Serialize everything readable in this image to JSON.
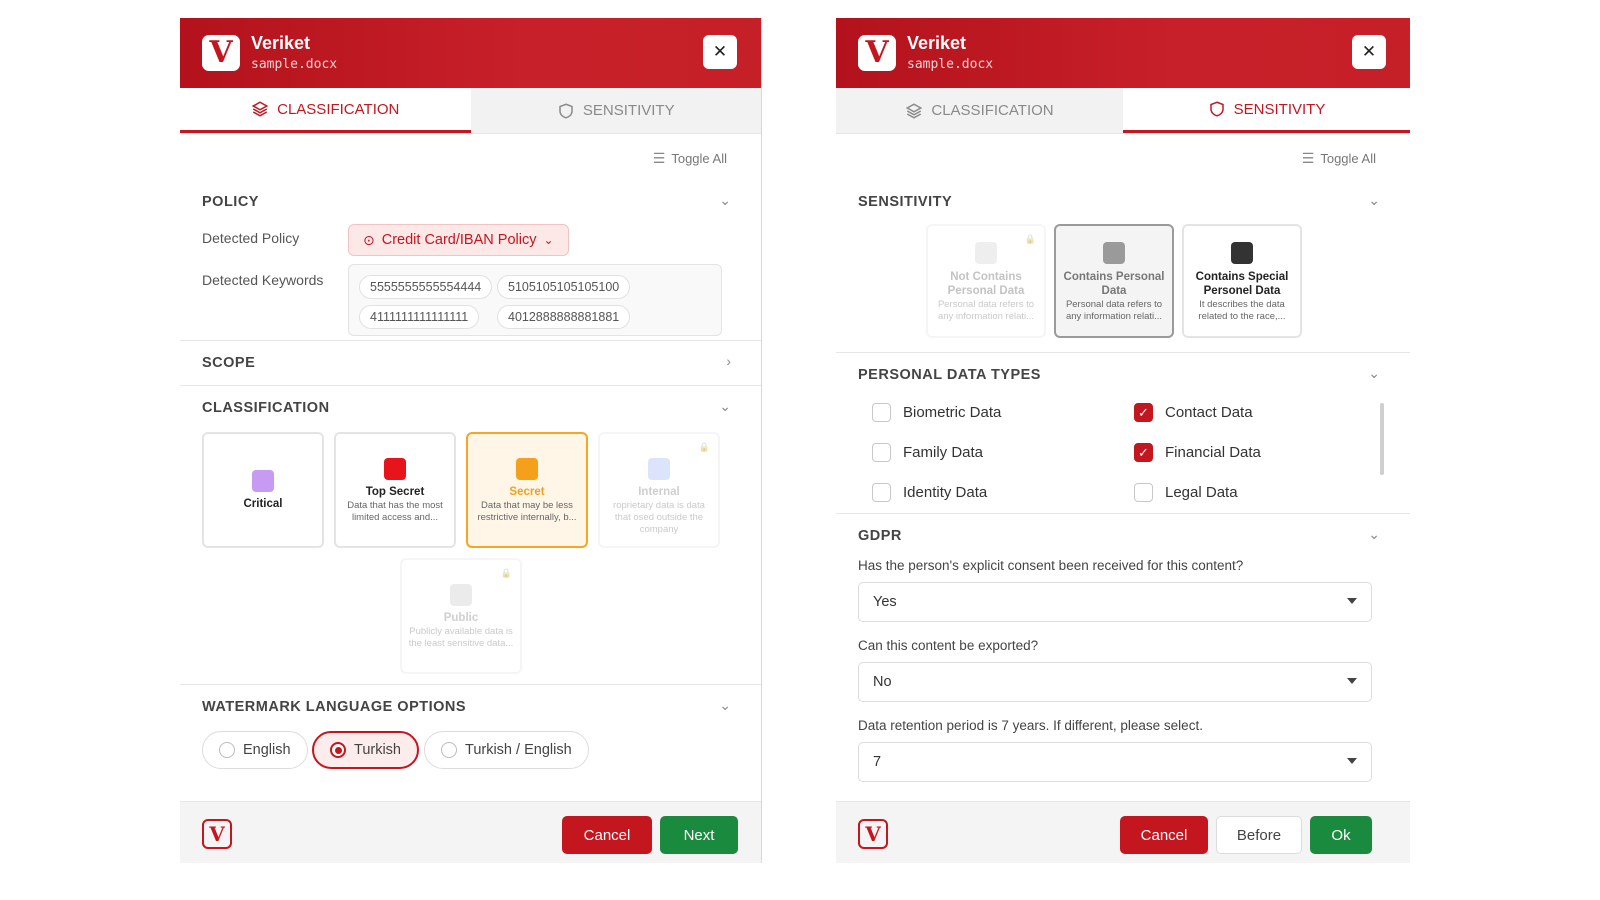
{
  "left": {
    "app_title": "Veriket",
    "file_name": "sample.docx",
    "close_label": "✕",
    "tabs": [
      {
        "label": "CLASSIFICATION"
      },
      {
        "label": "SENSITIVITY"
      }
    ],
    "active_tab": "CLASSIFICATION",
    "toggle_all": "Toggle All",
    "policy": {
      "title": "POLICY",
      "detected_policy_label": "Detected Policy",
      "detected_policy_value": "Credit Card/IBAN Policy",
      "detected_keywords_label": "Detected Keywords",
      "keywords": [
        "5555555555554444",
        "5105105105105100",
        "4111111111111111",
        "4012888888881881"
      ]
    },
    "scope": {
      "title": "SCOPE"
    },
    "classification": {
      "title": "CLASSIFICATION",
      "selected": "Secret",
      "cards": [
        {
          "name": "Critical",
          "desc": "",
          "color": "#c79bf2",
          "state": "normal"
        },
        {
          "name": "Top Secret",
          "desc": "Data that has the most limited access and...",
          "color": "#e8141c",
          "state": "normal"
        },
        {
          "name": "Secret",
          "desc": "Data that may be less restrictive internally, b...",
          "color": "#f5a01a",
          "state": "selected"
        },
        {
          "name": "Internal",
          "desc": "roprietary data is data that osed outside the company",
          "color": "#9ab3f5",
          "state": "faded"
        },
        {
          "name": "Public",
          "desc": "Publicly available data is the least sensitive data...",
          "color": "#c8c8c8",
          "state": "faded"
        }
      ]
    },
    "watermark": {
      "title": "WATERMARK LANGUAGE OPTIONS",
      "options": [
        "English",
        "Turkish",
        "Turkish / English"
      ],
      "selected": "Turkish"
    },
    "footer": {
      "logo_letter": "V",
      "cancel": "Cancel",
      "next": "Next"
    }
  },
  "right": {
    "app_title": "Veriket",
    "file_name": "sample.docx",
    "close_label": "✕",
    "tabs": [
      {
        "label": "CLASSIFICATION"
      },
      {
        "label": "SENSITIVITY"
      }
    ],
    "active_tab": "SENSITIVITY",
    "toggle_all": "Toggle All",
    "sensitivity": {
      "title": "SENSITIVITY",
      "selected": "Contains Personal Data",
      "cards": [
        {
          "name": "Not Contains Personal Data",
          "desc": "Personal data refers to any information relati...",
          "color": "#cfcfcf",
          "state": "faded"
        },
        {
          "name": "Contains Personal Data",
          "desc": "Personal data refers to any information relati...",
          "color": "#9a9a9a",
          "state": "selected"
        },
        {
          "name": "Contains Special Personel Data",
          "desc": "It describes the data related to the race,...",
          "color": "#333333",
          "state": "normal"
        }
      ]
    },
    "personal_data_types": {
      "title": "PERSONAL DATA TYPES",
      "items": [
        {
          "label": "Biometric Data",
          "checked": false
        },
        {
          "label": "Contact Data",
          "checked": true
        },
        {
          "label": "Family Data",
          "checked": false
        },
        {
          "label": "Financial Data",
          "checked": true
        },
        {
          "label": "Identity Data",
          "checked": false
        },
        {
          "label": "Legal Data",
          "checked": false
        }
      ]
    },
    "gdpr": {
      "title": "GDPR",
      "questions": [
        {
          "question": "Has the person's explicit consent been received for this content?",
          "value": "Yes"
        },
        {
          "question": "Can this content be exported?",
          "value": "No"
        },
        {
          "question": "Data retention period is 7 years. If different, please select.",
          "value": "7"
        }
      ]
    },
    "footer": {
      "logo_letter": "V",
      "cancel": "Cancel",
      "before": "Before",
      "ok": "Ok"
    }
  },
  "colors": {
    "brand_red": "#c4161f",
    "ok_green": "#1a8a3e",
    "secret_orange": "#f5a623"
  }
}
